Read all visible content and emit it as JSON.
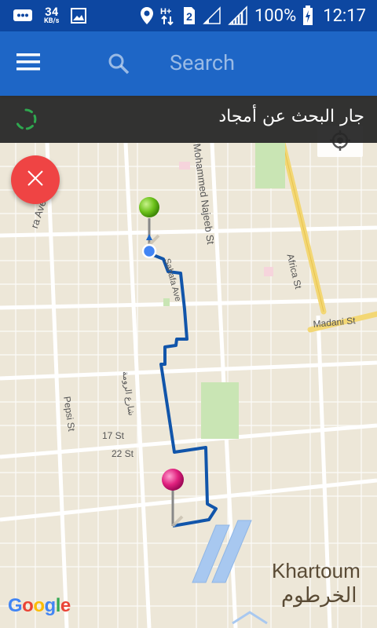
{
  "status_bar": {
    "speed_value": "34",
    "speed_unit": "KB/s",
    "network_type": "H+",
    "sim_slot": "2",
    "battery": "100%",
    "time": "12:17"
  },
  "app_bar": {
    "search_placeholder": "Search",
    "menu_icon": "hamburger-menu-icon",
    "search_icon": "search-icon"
  },
  "banner": {
    "text": "جار البحث عن أمجاد"
  },
  "map": {
    "streets": {
      "mohammed_najeeb": "Mohammed Najeeb St",
      "africa": "Africa St",
      "madani": "Madani St",
      "pepsi": "Pepsi St",
      "st17": "17 St",
      "st22": "22 St",
      "sahafa": "Sahafa Ave",
      "ra_ave": "ra Ave",
      "arabic_street": "شارع الرومة"
    },
    "city_en": "Khartoum",
    "city_ar": "الخرطوم",
    "logo": "Google",
    "start_marker": "green-pin",
    "end_marker": "pink-pin",
    "route_color": "#1155aa"
  }
}
